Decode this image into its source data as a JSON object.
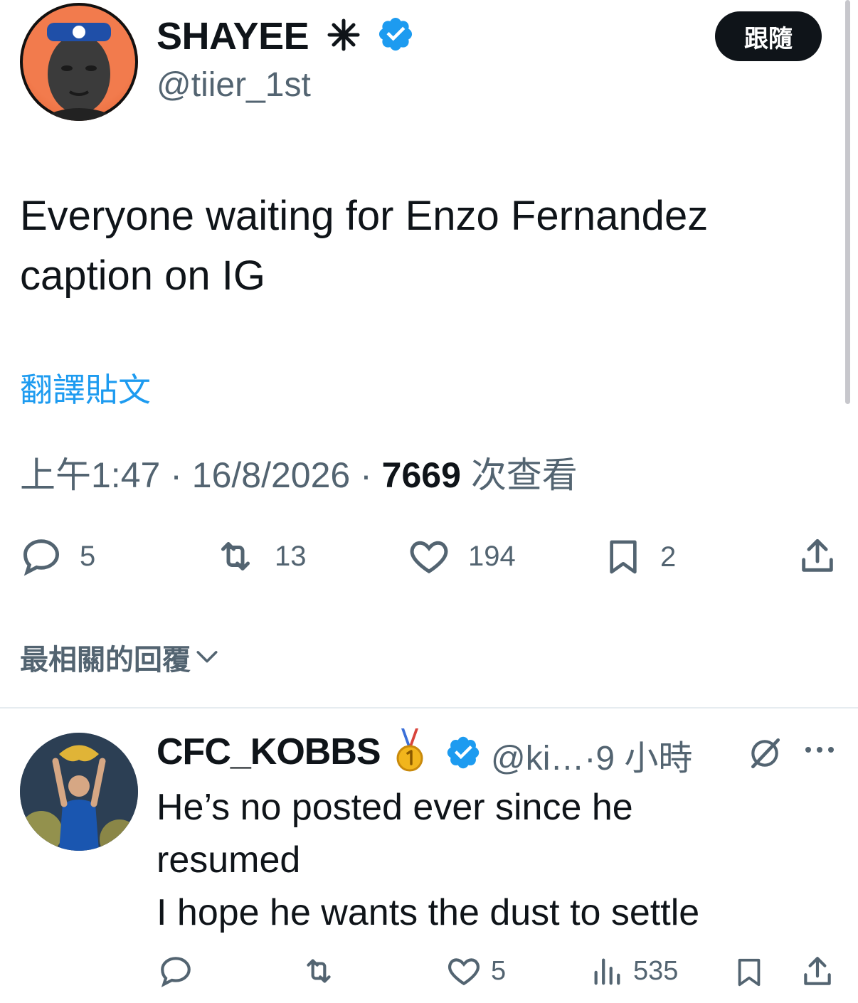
{
  "tweet": {
    "author_name": "SHAYEE",
    "author_handle": "@tiier_1st",
    "follow_label": "跟隨",
    "text": "Everyone waiting for Enzo Fernandez caption on IG",
    "translate_label": "翻譯貼文",
    "time": "上午1:47",
    "date": "16/8/2026",
    "views_count": "7669",
    "views_label": "次查看",
    "replies": "5",
    "retweets": "13",
    "likes": "194",
    "bookmarks": "2"
  },
  "sort_label": "最相關的回覆",
  "reply": {
    "author_name": "CFC_KOBBS",
    "handle_time": "@ki…·9 小時",
    "text_line1": "He’s no posted ever since he",
    "text_line2": "resumed",
    "text_line3": "I hope he wants the dust to settle",
    "likes": "5",
    "views": "535"
  },
  "colors": {
    "accent": "#1d9bf0",
    "text": "#0f1419",
    "muted": "#536471",
    "verified": "#1d9bf0"
  }
}
